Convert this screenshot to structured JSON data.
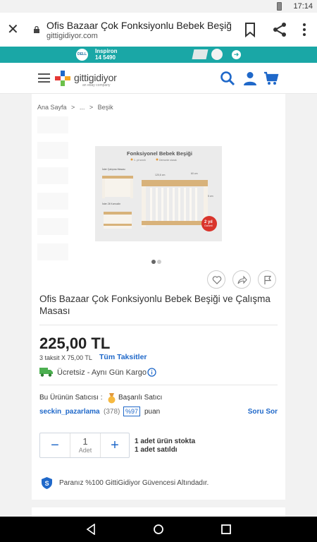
{
  "status_bar": {
    "time": "17:14"
  },
  "browser": {
    "page_title": "Ofis Bazaar Çok Fonksiyonlu Bebek Beşiği ve Ç...",
    "host": "gittigidiyor.com"
  },
  "promo": {
    "brand": "DELL",
    "model_line1": "Inspiron",
    "model_line2": "14 5490"
  },
  "header": {
    "logo_text": "gittigidiyor",
    "logo_sub": "an ebay company"
  },
  "breadcrumb": [
    "Ana Sayfa",
    ">",
    "...",
    ">",
    "Beşik"
  ],
  "product": {
    "title": "Ofis Bazaar Çok Fonksiyonlu Bebek Beşiği ve Çalışma Masası",
    "price": "225,00 TL",
    "installment": "3 taksit X 75,00 TL",
    "installment_link": "Tüm Taksitler",
    "shipping": "Ücretsiz - Aynı Gün Kargo",
    "image": {
      "heading": "Fonksiyonel Bebek Beşiği",
      "legend_1": "1. yıl sınırlı",
      "legend_2": "Demonte olarak",
      "label_desk": "İster Çalışma Masası",
      "label_nightstand": "İster 2li Komodin",
      "dim_width": "120,6 cm",
      "dim_depth": "60 cm",
      "dim_height": "95 cm",
      "warranty_1": "2 yıl",
      "warranty_2": "Garanti"
    },
    "gallery_dots": 2,
    "gallery_active": 1
  },
  "seller": {
    "label": "Bu Ürünün Satıcısı :",
    "badge": "Başarılı Satıcı",
    "name": "seckin_pazarlama",
    "review_count": "(378)",
    "score": "%97",
    "score_unit": "puan",
    "ask_link": "Soru Sor"
  },
  "purchase": {
    "quantity": "1",
    "unit": "Adet",
    "minus": "−",
    "plus": "+",
    "stock_line1": "1 adet ürün stokta",
    "stock_line2": "1 adet satıldı"
  },
  "guarantee": "Paranız %100 GittiGidiyor Güvencesi Altındadır.",
  "colors": {
    "brand_blue": "#1f68c9",
    "promo_teal": "#1aa7a6",
    "truck_green": "#4caf50"
  },
  "icons": [
    "battery-icon",
    "close-icon",
    "lock-icon",
    "bookmark-icon",
    "share-icon",
    "more-vert-icon",
    "menu-icon",
    "search-icon",
    "user-icon",
    "cart-icon",
    "heart-icon",
    "share-arrow-icon",
    "flag-icon",
    "truck-icon",
    "info-icon",
    "medal-icon",
    "shield-icon",
    "back-icon",
    "home-icon",
    "recents-icon"
  ]
}
